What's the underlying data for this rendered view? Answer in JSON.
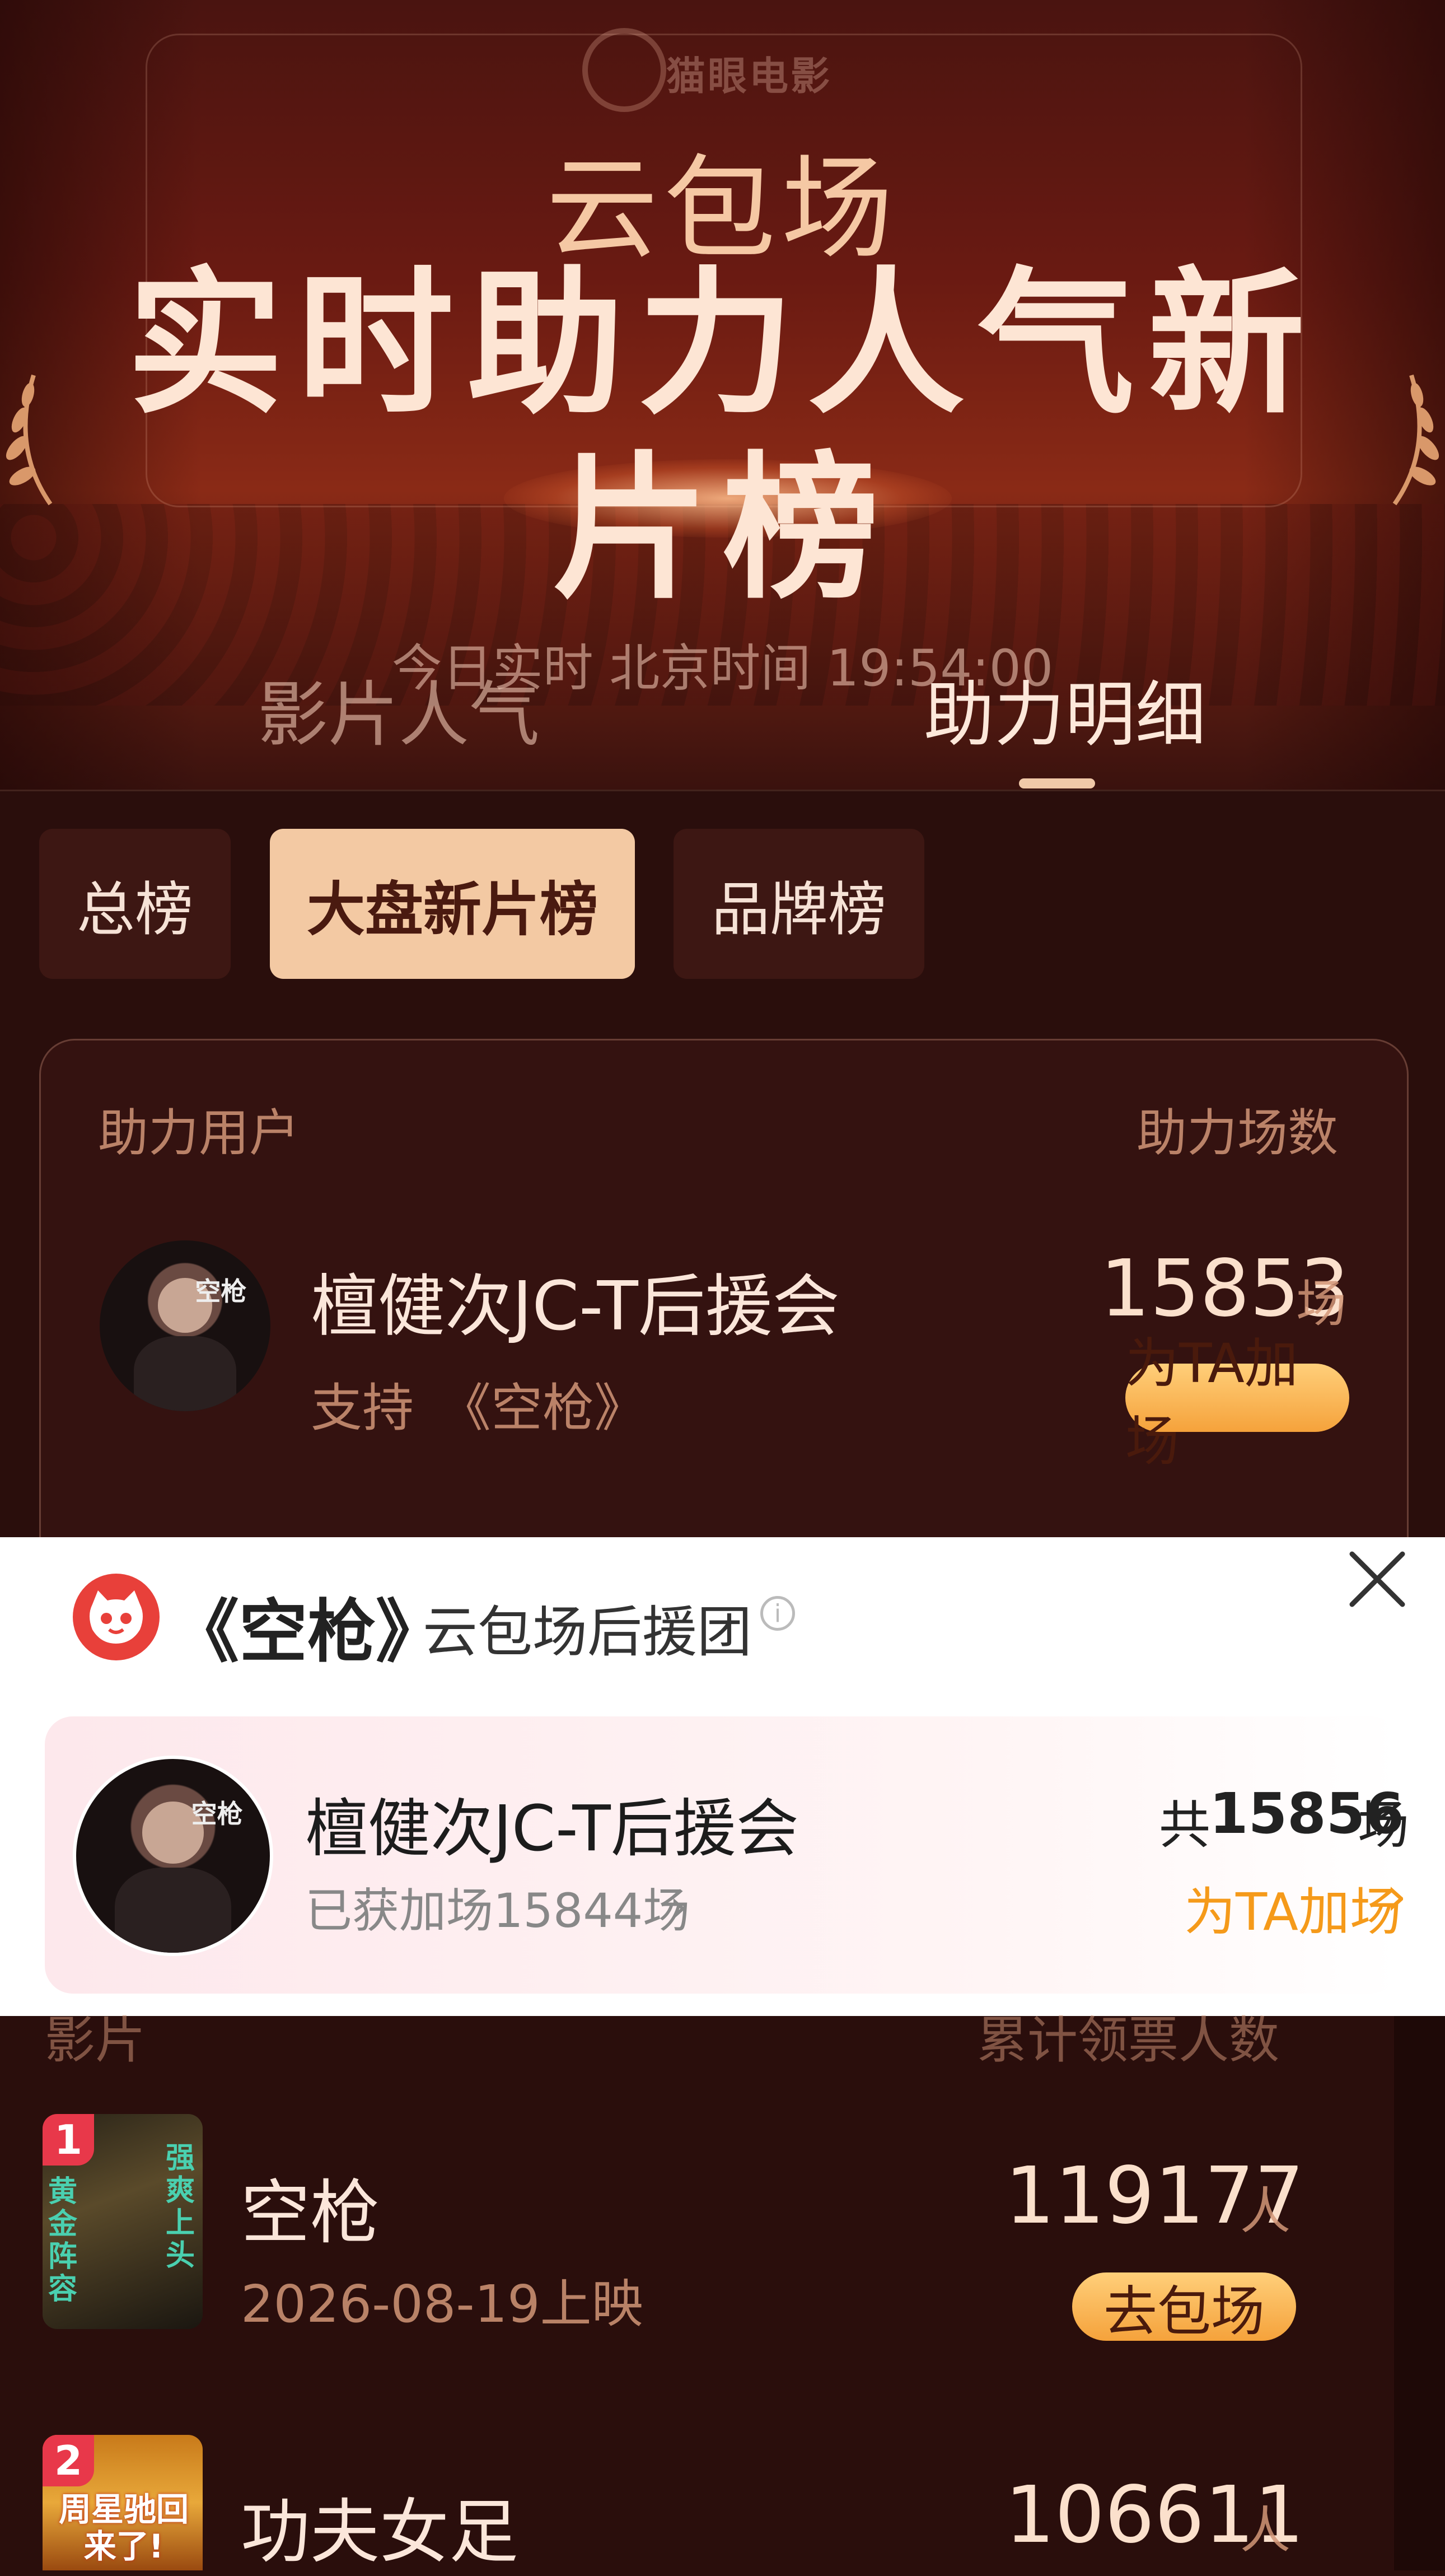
{
  "header": {
    "brand": "猫眼电影",
    "subtitle": "云包场",
    "title": "实时助力人气新片榜",
    "realtime": "今日实时 北京时间 19:54:00"
  },
  "tabs": [
    {
      "label": "影片人气",
      "active": false
    },
    {
      "label": "助力明细",
      "active": true
    }
  ],
  "chips": [
    {
      "label": "总榜",
      "active": false
    },
    {
      "label": "大盘新片榜",
      "active": true
    },
    {
      "label": "品牌榜",
      "active": false
    }
  ],
  "support_panel": {
    "col_user": "助力用户",
    "col_count": "助力场数",
    "top_user": {
      "name": "檀健次JC-T后援会",
      "support_prefix": "支持",
      "support_film": "《空枪》",
      "count": "15853",
      "unit": "场",
      "action": "为TA加场"
    }
  },
  "popup": {
    "film": "《空枪》",
    "group": "云包场后援团",
    "info_icon": "info-icon",
    "close_icon": "close-icon",
    "card": {
      "avatar_text": "空枪",
      "name": "檀健次JC-T后援会",
      "gained": "已获加场15844场",
      "total_prefix": "共",
      "total": "15856",
      "total_unit": "场",
      "action": "为TA加场"
    }
  },
  "film_list": {
    "col_film": "影片",
    "col_count": "累计领票人数",
    "items": [
      {
        "rank": "1",
        "title": "空枪",
        "release": "2026-08-19上映",
        "count": "119177",
        "unit": "人",
        "action": "去包场",
        "poster_text_a": "黄金阵容",
        "poster_text_b": "强爽上头"
      },
      {
        "rank": "2",
        "title": "功夫女足",
        "count": "106611",
        "unit": "人",
        "poster_text_a": "周星驰回来了!"
      }
    ]
  },
  "colors": {
    "accent": "#f3c9a3",
    "pill": "#f5a23b",
    "orange_text": "#f59a1a",
    "rank_badge": "#e8384a"
  }
}
